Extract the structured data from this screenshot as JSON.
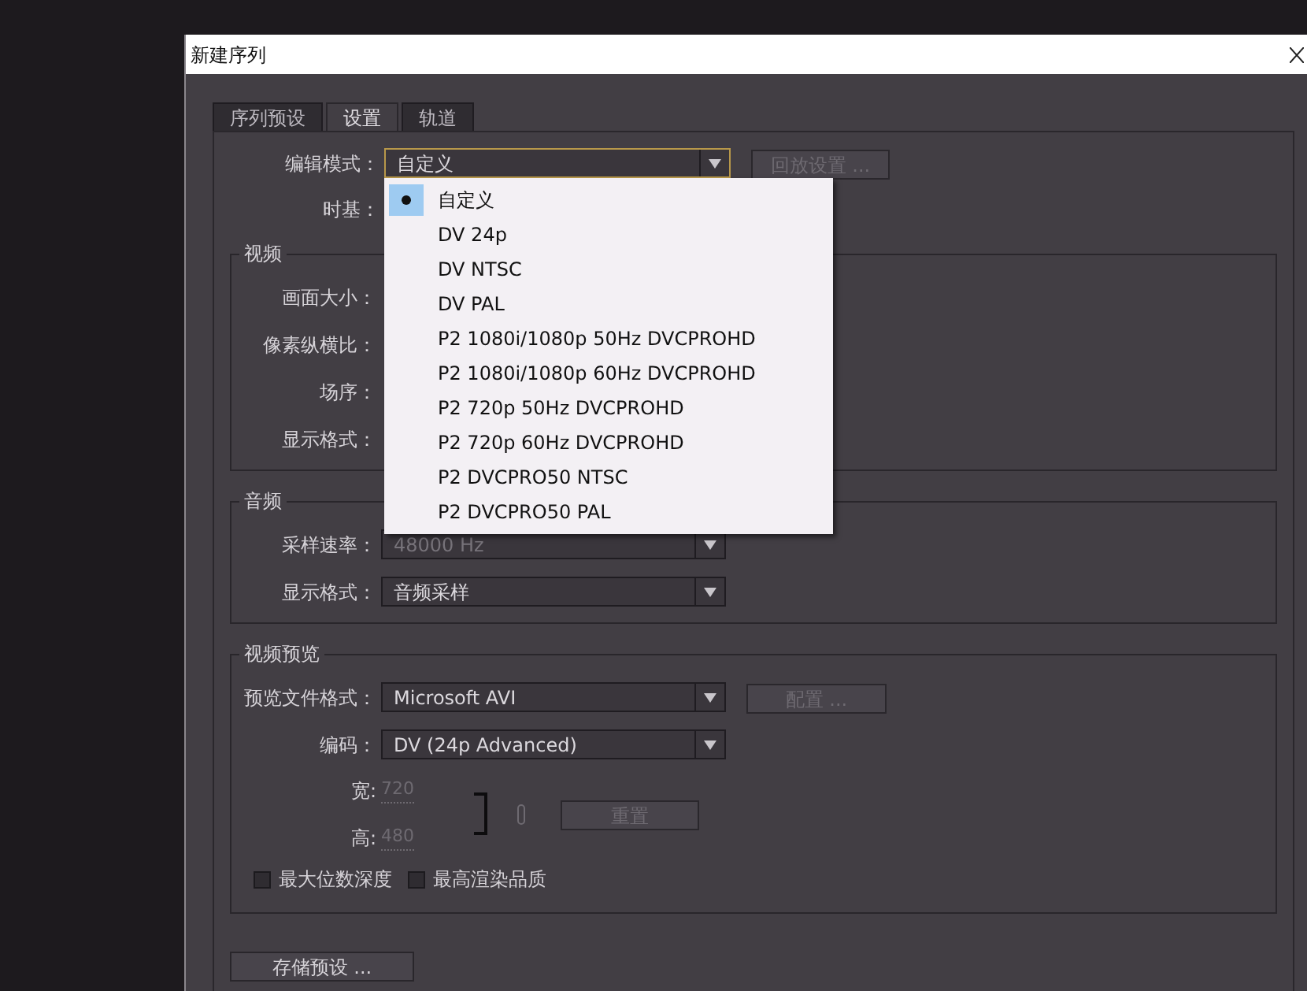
{
  "window": {
    "title": "新建序列"
  },
  "tabs": [
    {
      "label": "序列预设",
      "selected": false
    },
    {
      "label": "设置",
      "selected": true
    },
    {
      "label": "轨道",
      "selected": false
    }
  ],
  "general": {
    "rows": [
      {
        "label": "编辑模式：",
        "field": {
          "value": "自定义",
          "disabled": false,
          "focused": true
        },
        "button": {
          "label": "回放设置 ...",
          "disabled": true
        }
      },
      {
        "label": "时基："
      }
    ]
  },
  "groups": [
    {
      "title": "视频",
      "rows": [
        {
          "label": "画面大小："
        },
        {
          "label": "像素纵横比："
        },
        {
          "label": "场序："
        },
        {
          "label": "显示格式："
        }
      ]
    },
    {
      "title": "音频",
      "rows": [
        {
          "label": "采样速率：",
          "field": {
            "value": "48000 Hz",
            "disabled": true,
            "focused": false
          }
        },
        {
          "label": "显示格式：",
          "field": {
            "value": "音频采样",
            "disabled": false,
            "focused": false
          }
        }
      ]
    }
  ],
  "video_preview": {
    "title": "视频预览",
    "rows": [
      {
        "label": "预览文件格式：",
        "field": {
          "value": "Microsoft AVI",
          "disabled": false,
          "focused": false
        },
        "button": {
          "label": "配置 ...",
          "disabled": true
        }
      },
      {
        "label": "编码：",
        "field": {
          "value": "DV (24p Advanced)",
          "disabled": false,
          "focused": false
        }
      }
    ],
    "width": {
      "label": "宽:",
      "value": "720",
      "disabled": true
    },
    "height": {
      "label": "高:",
      "value": "480",
      "disabled": true
    },
    "reset_button": {
      "label": "重置",
      "disabled": true
    },
    "checkboxes": [
      {
        "label": "最大位数深度",
        "checked": false
      },
      {
        "label": "最高渲染品质",
        "checked": false
      }
    ]
  },
  "save_button": {
    "label": "存储预设 ..."
  },
  "dropdown_menu": {
    "items": [
      {
        "label": "自定义",
        "selected": true
      },
      {
        "label": "DV 24p",
        "selected": false
      },
      {
        "label": "DV NTSC",
        "selected": false
      },
      {
        "label": "DV PAL",
        "selected": false
      },
      {
        "label": "P2 1080i/1080p 50Hz DVCPROHD",
        "selected": false
      },
      {
        "label": "P2 1080i/1080p 60Hz DVCPROHD",
        "selected": false
      },
      {
        "label": "P2 720p 50Hz DVCPROHD",
        "selected": false
      },
      {
        "label": "P2 720p 60Hz DVCPROHD",
        "selected": false
      },
      {
        "label": "P2 DVCPRO50 NTSC",
        "selected": false
      },
      {
        "label": "P2 DVCPRO50 PAL",
        "selected": false
      }
    ]
  }
}
